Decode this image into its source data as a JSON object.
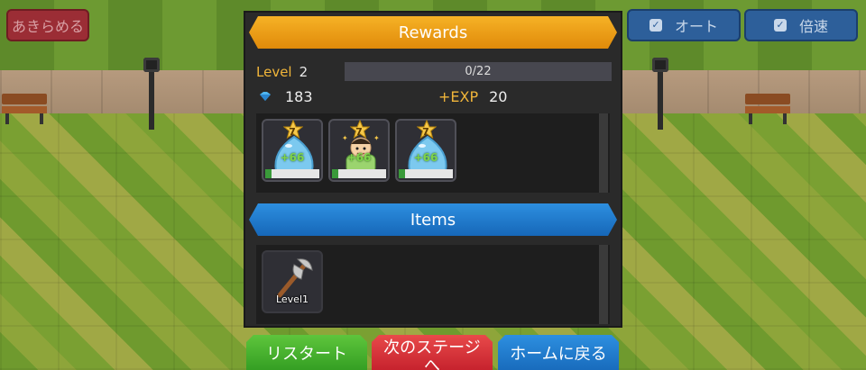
{
  "top_left": {
    "quit_label": "あきらめる"
  },
  "top_right": {
    "auto_label": "オート",
    "speed_label": "倍速",
    "checkbox_mark": "✓"
  },
  "rewards": {
    "title": "Rewards",
    "level_label": "Level",
    "level_value": "2",
    "progress_text": "0/22",
    "progress_fraction": 0,
    "gems": "183",
    "exp_label": "+EXP",
    "exp_value": "20",
    "units": [
      {
        "type": "blue-slime",
        "star_rank": "7",
        "level_text": "+66"
      },
      {
        "type": "green-villager",
        "star_rank": "7",
        "level_text": "+66"
      },
      {
        "type": "blue-slime",
        "star_rank": "7",
        "level_text": "+66"
      }
    ]
  },
  "items": {
    "title": "Items",
    "list": [
      {
        "type": "battle-axe",
        "level_text": "Level1"
      }
    ]
  },
  "bottom": {
    "restart_label": "リスタート",
    "next_stage_label": "次のステージへ",
    "home_label": "ホームに戻る"
  },
  "colors": {
    "rewards_header": "#f0a01a",
    "items_header": "#1f7fd0",
    "restart": "#4aae2c",
    "next_stage": "#d83038",
    "home": "#1f7fd0",
    "accent_text": "#f0b53a"
  }
}
